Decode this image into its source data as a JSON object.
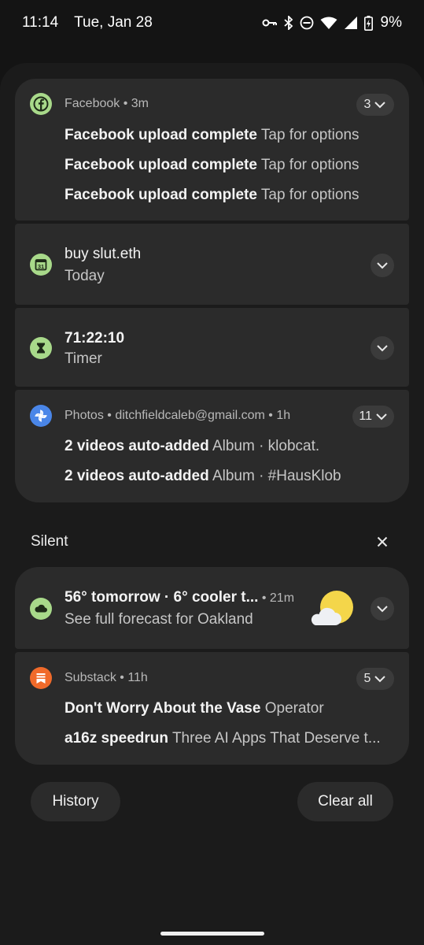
{
  "status_bar": {
    "time": "11:14",
    "date": "Tue, Jan 28",
    "battery": "9%",
    "icons": [
      "vpn-key-icon",
      "bluetooth-icon",
      "do-not-disturb-icon",
      "wifi-icon",
      "signal-icon",
      "battery-charging-icon"
    ]
  },
  "alerting": {
    "facebook": {
      "app": "Facebook",
      "time": "3m",
      "count": "3",
      "icon": "facebook-icon",
      "icon_color": "#a8d98a",
      "messages": [
        {
          "title": "Facebook upload complete",
          "text": "Tap for options"
        },
        {
          "title": "Facebook upload complete",
          "text": "Tap for options"
        },
        {
          "title": "Facebook upload complete",
          "text": "Tap for options"
        }
      ]
    },
    "calendar": {
      "title": "buy slut.eth",
      "subtitle": "Today",
      "icon": "calendar-icon",
      "icon_text": "31",
      "icon_color": "#a8d98a"
    },
    "timer": {
      "title": "71:22:10",
      "subtitle": "Timer",
      "icon": "hourglass-icon",
      "icon_color": "#a8d98a"
    },
    "photos": {
      "app": "Photos",
      "account": "ditchfieldcaleb@gmail.com",
      "time": "1h",
      "count": "11",
      "icon": "photos-pinwheel-icon",
      "icon_color": "#4a86e8",
      "messages": [
        {
          "title": "2 videos auto-added",
          "text": "Album · klobcat."
        },
        {
          "title": "2 videos auto-added",
          "text": "Album · #HausKlob"
        }
      ]
    }
  },
  "silent": {
    "header": "Silent",
    "close_icon": "close-icon",
    "weather": {
      "title": "56° tomorrow · 6° cooler t...",
      "time": "21m",
      "subtitle": "See full forecast for Oakland",
      "icon": "cloud-icon",
      "icon_color": "#a8d98a",
      "image": "partly-cloudy-icon"
    },
    "substack": {
      "app": "Substack",
      "time": "11h",
      "count": "5",
      "icon": "substack-icon",
      "icon_color": "#f06a2a",
      "messages": [
        {
          "title": "Don't Worry About the Vase",
          "text": "Operator"
        },
        {
          "title": "a16z speedrun",
          "text": "Three AI Apps That Deserve t..."
        }
      ]
    }
  },
  "actions": {
    "history": "History",
    "clear_all": "Clear all"
  }
}
